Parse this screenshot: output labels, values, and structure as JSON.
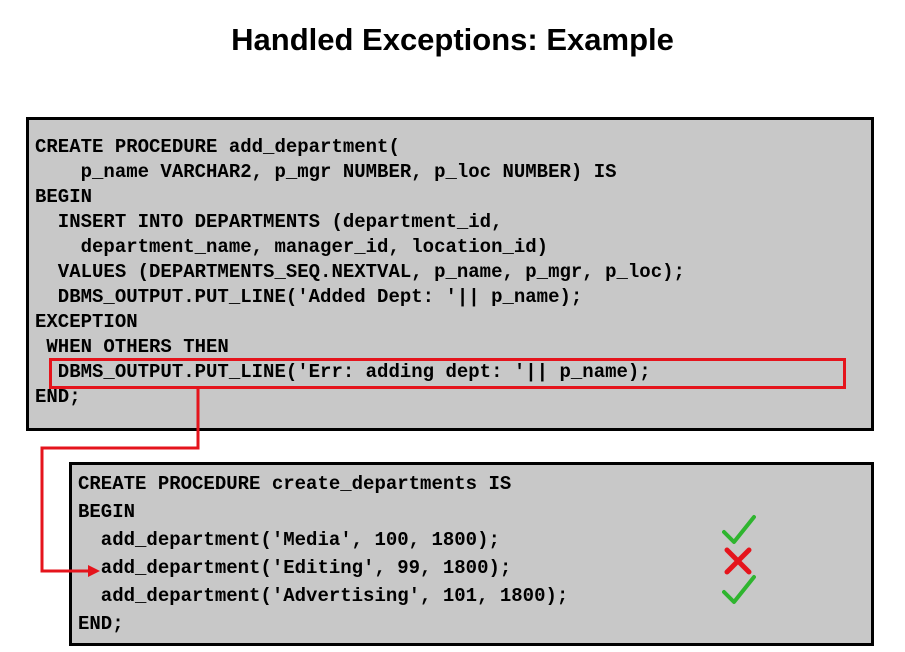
{
  "slide": {
    "title": "Handled Exceptions: Example"
  },
  "procedure1": {
    "lines": [
      "CREATE PROCEDURE add_department(",
      "    p_name VARCHAR2, p_mgr NUMBER, p_loc NUMBER) IS",
      "BEGIN",
      "  INSERT INTO DEPARTMENTS (department_id,",
      "    department_name, manager_id, location_id)",
      "  VALUES (DEPARTMENTS_SEQ.NEXTVAL, p_name, p_mgr, p_loc);",
      "  DBMS_OUTPUT.PUT_LINE('Added Dept: '|| p_name);",
      "EXCEPTION",
      " WHEN OTHERS THEN",
      "  DBMS_OUTPUT.PUT_LINE('Err: adding dept: '|| p_name);",
      "END;"
    ]
  },
  "procedure2": {
    "lines": [
      "CREATE PROCEDURE create_departments IS",
      "BEGIN",
      "  add_department('Media', 100, 1800);",
      "  add_department('Editing', 99, 1800);",
      "  add_department('Advertising', 101, 1800);",
      "END;"
    ]
  },
  "status_marks": [
    {
      "icon": "checkmark-icon",
      "color": "#2fb52f"
    },
    {
      "icon": "cross-icon",
      "color": "#e5141c"
    },
    {
      "icon": "checkmark-icon",
      "color": "#2fb52f"
    }
  ],
  "colors": {
    "highlight": "#e5141c",
    "code_background": "#c8c8c8"
  }
}
